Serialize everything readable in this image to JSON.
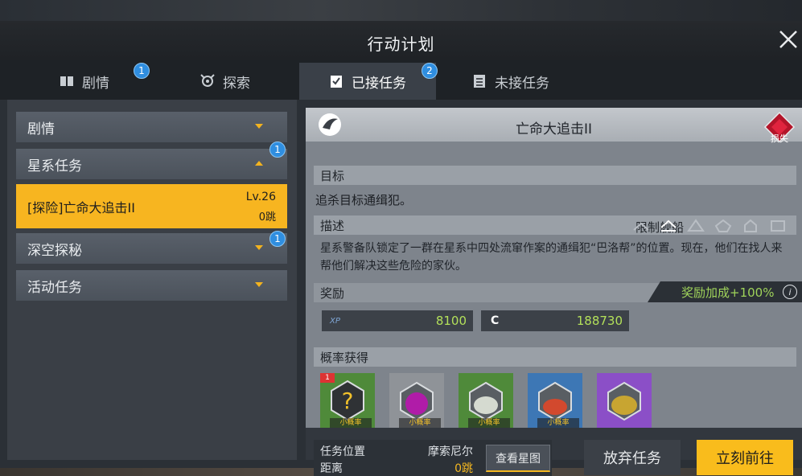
{
  "window": {
    "title": "行动计划"
  },
  "tabs": [
    {
      "label": "剧情",
      "badge": "1"
    },
    {
      "label": "探索",
      "badge": ""
    },
    {
      "label": "已接任务",
      "badge": "2"
    },
    {
      "label": "未接任务",
      "badge": ""
    }
  ],
  "sidebar": {
    "categories": [
      {
        "label": "剧情",
        "badge": ""
      },
      {
        "label": "星系任务",
        "badge": "1"
      },
      {
        "label": "深空探秘",
        "badge": "1"
      },
      {
        "label": "活动任务",
        "badge": ""
      }
    ],
    "selected_quest": {
      "name": "[探险]亡命大追击II",
      "level": "Lv.26",
      "jumps": "0跳"
    }
  },
  "detail": {
    "quest_title": "亡命大追击II",
    "loss_label": "损失",
    "goal_header": "目标",
    "goal_text": "追杀目标通缉犯。",
    "desc_header": "描述",
    "limit_label": "限制舰船",
    "desc_text": "星系警备队锁定了一群在星系中四处流窜作案的通缉犯“巴洛帮”的位置。现在，他们在找人来帮他们解决这些危险的家伙。",
    "reward_header": "奖励",
    "reward_bonus": "奖励加成+100%",
    "xp_label": "XP",
    "xp_value": "8100",
    "credit_label": "C",
    "credit_value": "188730",
    "drops_header": "概率获得",
    "drops": [
      {
        "tag": "小概率",
        "badge": "1",
        "color": "#4f8a3a"
      },
      {
        "tag": "小概率",
        "badge": "",
        "color": "#8f9398"
      },
      {
        "tag": "小概率",
        "badge": "",
        "color": "#4f8a3a"
      },
      {
        "tag": "小概率",
        "badge": "",
        "color": "#3d77b5"
      },
      {
        "tag": "",
        "badge": "",
        "color": "#8b4fc7"
      }
    ],
    "location_label": "任务位置",
    "location_value": "摩索尼尔",
    "distance_label": "距离",
    "distance_value": "0跳",
    "view_map_label": "查看星图",
    "abandon_label": "放弃任务",
    "goto_label": "立刻前往"
  },
  "colors": {
    "accent": "#f7b520",
    "bonus": "#9fd35a",
    "badge": "#2f8ee0"
  }
}
